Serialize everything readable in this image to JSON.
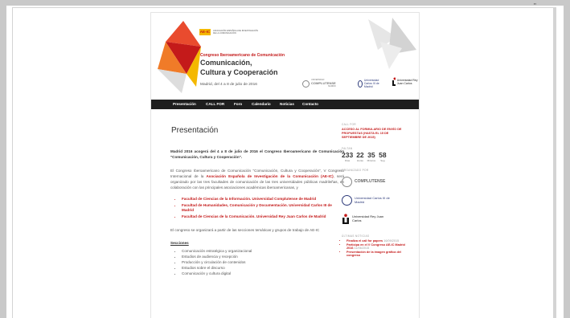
{
  "top_mark": "\"",
  "header": {
    "logo_badge": "AE-IC",
    "logo_text": "ASOCIACIÓN ESPAÑOLA DE INVESTIGACIÓN DE LA COMUNICACIÓN",
    "congreso": "Congreso Iberoamericano de Comunicación",
    "title_line1": "Comunicación,",
    "title_line2": "Cultura y Cooperación",
    "date": "Madrid, del 4 a 8 de julio de 2016",
    "universities": [
      "COMPLUTENSE",
      "Universidad Carlos III de Madrid",
      "Universidad Rey Juan Carlos"
    ],
    "complutense_sub": "UNIVERSIDAD",
    "complutense_city": "MADRID"
  },
  "nav": [
    "Presentación",
    "CALL FOR",
    "Foro",
    "Calendario",
    "Noticias",
    "Contacto"
  ],
  "main": {
    "title": "Presentación",
    "lead": "Madrid 2016 acogerá del 4 a 8 de julio de 2016 el Congreso Iberoamericano de Comunicación \"Comunicación, Cultura y Cooperación\".",
    "body_1": "El Congreso Iberoamericano de Comunicación \"Comunicación, Cultura y Cooperación\", V Congreso Internacional de la",
    "body_1_link": "Asociación Española de Investigación de la Comunicación (AE-IC)",
    "body_1_rest": ", será organizado por las tres facultades de comunicación de las tres universidades públicas madrileñas, en colaboración con las principales asociaciones académicas iberoamericanas, y",
    "faculties": [
      "Facultad de Ciencias de la Información. Universidad Complutense de Madrid",
      "Facultad de Humanidades, Comunicación y Documentación. Universidad Carlos III de Madrid",
      "Facultad de Ciencias de la Comunicación. Universidad Rey Juan Carlos de Madrid"
    ],
    "body_2": "El congreso se organizará a partir de las secciones temáticas y grupos de trabajo de AE-IC",
    "secciones_label": "Secciones",
    "secciones": [
      "Comunicación estratégica y organizacional",
      "Estudios de audiencia y recepción",
      "Producción y circulación de contenidos",
      "Estudios sobre el discurso",
      "Comunicación y cultura digital"
    ]
  },
  "sidebar": {
    "call_label": "CALL FOR",
    "call_link": "ACCESO AL FORMULARIO DE ENVÍO DE PROPUESTAS (HASTA EL 15 DE SEPTIEMBRE DE 2015)",
    "faltan_label": "FALTAN",
    "countdown": [
      {
        "num": "233",
        "unit": "Días"
      },
      {
        "num": "22",
        "unit": "Horas"
      },
      {
        "num": "35",
        "unit": "Minutos"
      },
      {
        "num": "58",
        "unit": "Seg"
      }
    ],
    "organizado_label": "ORGANIZADO POR",
    "org1": "COMPLUTENSE",
    "org2": "Universidad Carlos III de Madrid",
    "org3": "Universidad Rey Juan Carlos",
    "noticias_label": "ÚLTIMAS NOTICIAS",
    "news": [
      {
        "title": "Finaliza el call for papers",
        "date": "16/09/2015"
      },
      {
        "title": "Participa en el V Congreso AE-IC Madrid 2016",
        "date": "11/06/2015"
      },
      {
        "title": "Presentación de la imagen gráfica del congreso",
        "date": ""
      }
    ]
  },
  "colors": {
    "accent": "#c41a1a",
    "nav_bg": "#1e1e1e",
    "badge": "#f4b800"
  }
}
